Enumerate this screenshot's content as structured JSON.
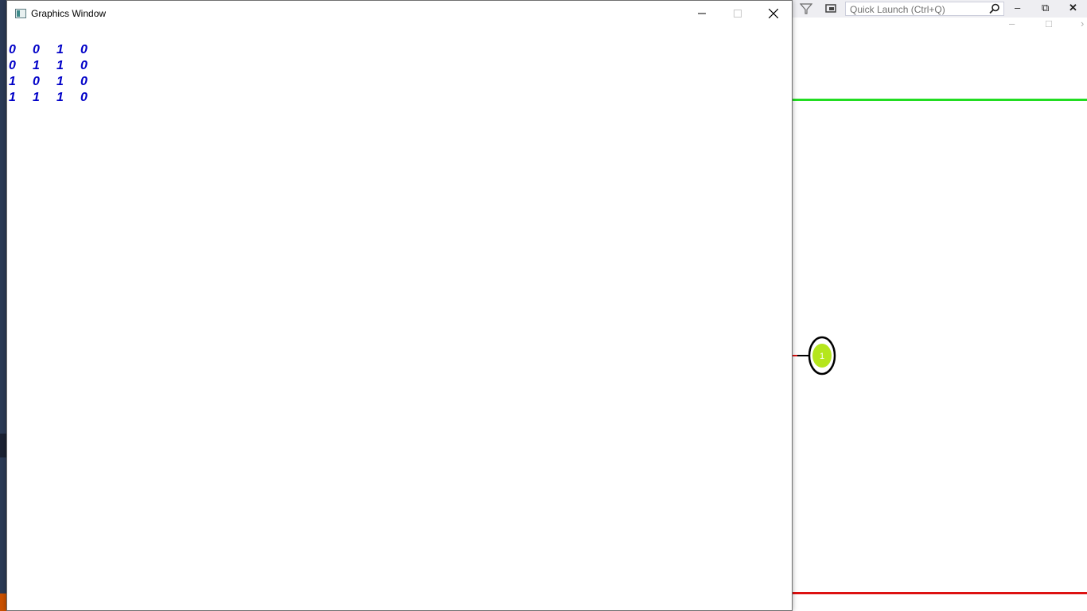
{
  "window": {
    "title": "Graphics Window",
    "controls": {
      "minimize": "minimize",
      "maximize": "maximize",
      "close": "close"
    }
  },
  "matrix": {
    "rows": [
      [
        "0",
        "0",
        "1",
        "0"
      ],
      [
        "0",
        "1",
        "1",
        "0"
      ],
      [
        "1",
        "0",
        "1",
        "0"
      ],
      [
        "1",
        "1",
        "1",
        "0"
      ]
    ],
    "color": "#0000c8"
  },
  "background_app": {
    "quick_launch_placeholder": "Quick Launch (Ctrl+Q)",
    "graph": {
      "node_label": "1",
      "node_fill": "#b5e61d",
      "top_line_color": "#22dd22",
      "bottom_line_color": "#dd1111"
    }
  },
  "icons": [
    "app-icon",
    "minimize-icon",
    "maximize-icon",
    "close-icon",
    "filter-icon",
    "search-icon"
  ]
}
